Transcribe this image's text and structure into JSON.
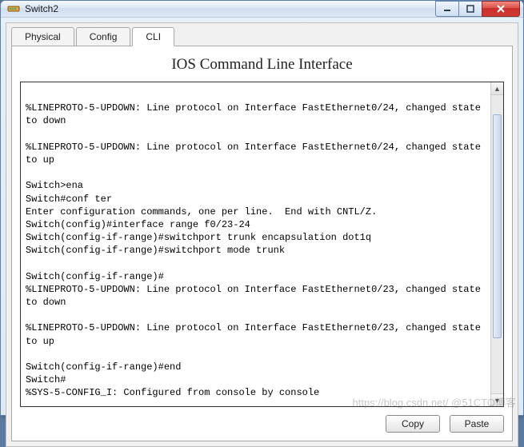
{
  "window": {
    "title": "Switch2"
  },
  "tabs": {
    "physical": "Physical",
    "config": "Config",
    "cli": "CLI"
  },
  "panel": {
    "title": "IOS Command Line Interface"
  },
  "terminal": {
    "text": "\n%LINEPROTO-5-UPDOWN: Line protocol on Interface FastEthernet0/24, changed state to down\n\n%LINEPROTO-5-UPDOWN: Line protocol on Interface FastEthernet0/24, changed state to up\n\nSwitch>ena\nSwitch#conf ter\nEnter configuration commands, one per line.  End with CNTL/Z.\nSwitch(config)#interface range f0/23-24\nSwitch(config-if-range)#switchport trunk encapsulation dot1q\nSwitch(config-if-range)#switchport mode trunk\n\nSwitch(config-if-range)#\n%LINEPROTO-5-UPDOWN: Line protocol on Interface FastEthernet0/23, changed state to down\n\n%LINEPROTO-5-UPDOWN: Line protocol on Interface FastEthernet0/23, changed state to up\n\nSwitch(config-if-range)#end\nSwitch#\n%SYS-5-CONFIG_I: Configured from console by console\n"
  },
  "buttons": {
    "copy": "Copy",
    "paste": "Paste"
  },
  "watermark": "https://blog.csdn.net/  @51CTO博客"
}
